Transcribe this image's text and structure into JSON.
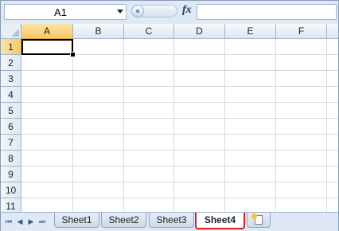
{
  "formula_bar": {
    "name_box": "A1",
    "fx_label": "fx",
    "formula_value": ""
  },
  "columns": [
    "A",
    "B",
    "C",
    "D",
    "E",
    "F"
  ],
  "rows": [
    "1",
    "2",
    "3",
    "4",
    "5",
    "6",
    "7",
    "8",
    "9",
    "10",
    "11"
  ],
  "sheet_tabs": [
    "Sheet1",
    "Sheet2",
    "Sheet3",
    "Sheet4"
  ],
  "active_sheet": "Sheet4",
  "nav_icons": [
    "first-sheet-icon",
    "prev-sheet-icon",
    "next-sheet-icon",
    "last-sheet-icon"
  ],
  "colors": {
    "header_bg": "#dfe8f5",
    "selected_header": "#f7c964",
    "active_tab_outline": "#d42020"
  }
}
